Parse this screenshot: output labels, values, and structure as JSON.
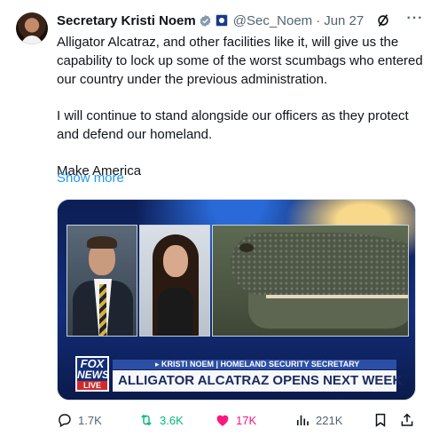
{
  "author": {
    "name": "Secretary Kristi Noem",
    "handle": "@Sec_Noem",
    "separator": "·",
    "date": "Jun 27"
  },
  "post": {
    "paragraph1": "Alligator Alcatraz, and other facilities like it, will give us the capability to lock up some of the worst scumbags who entered our country under the previous administration.",
    "paragraph2": "I will continue to stand alongside our officers as they protect and defend our homeland.",
    "paragraph3": "Make America",
    "show_more": "Show more"
  },
  "media": {
    "logo_line1": "FOX",
    "logo_line2": "NEWS",
    "logo_line3": "LIVE",
    "strap_top": "▸ KRISTI NOEM | HOMELAND SECURITY SECRETARY",
    "strap_headline": "ALLIGATOR ALCATRAZ OPENS NEXT WEEK"
  },
  "actions": {
    "replies": "1.7K",
    "reposts": "3.6K",
    "likes": "17K",
    "views": "221K"
  },
  "icons": {
    "verified": "verified-badge-icon",
    "gov": "government-badge-icon",
    "grok": "grok-icon",
    "more": "more-icon",
    "reply": "reply-icon",
    "repost": "repost-icon",
    "like": "heart-icon",
    "views": "views-icon",
    "bookmark": "bookmark-icon",
    "share": "share-icon"
  },
  "colors": {
    "link": "#1d9bf0",
    "repost_active": "#00ba7c",
    "like_active": "#f91880",
    "muted": "#536471"
  }
}
